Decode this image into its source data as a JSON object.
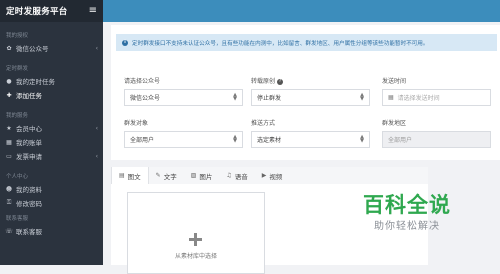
{
  "app": {
    "title": "定时发服务平台"
  },
  "sidebar": {
    "groups": [
      {
        "label": "我的授权",
        "items": [
          {
            "label": "微信公众号",
            "icon": "wechat-icon",
            "chevron": "‹"
          }
        ]
      },
      {
        "label": "定时群发",
        "items": [
          {
            "label": "我的定时任务",
            "icon": "list-icon"
          },
          {
            "label": "添加任务",
            "icon": "plus-icon"
          }
        ]
      },
      {
        "label": "我的服务",
        "items": [
          {
            "label": "会员中心",
            "icon": "star-icon",
            "chevron": "‹"
          },
          {
            "label": "我的账单",
            "icon": "bill-icon"
          },
          {
            "label": "发票申请",
            "icon": "invoice-icon",
            "chevron": "‹"
          }
        ]
      },
      {
        "label": "个人中心",
        "items": [
          {
            "label": "我的资料",
            "icon": "user-icon"
          },
          {
            "label": "修改密码",
            "icon": "key-icon"
          }
        ]
      },
      {
        "label": "联系客服",
        "items": [
          {
            "label": "联系客服",
            "icon": "support-icon"
          }
        ]
      }
    ]
  },
  "alert": {
    "text": "定时群发接口不支持未认证公众号，且有些功能在内测中，比如留言、群发地区、用户属性分组等该些功能暂时不可用。"
  },
  "form": {
    "account": {
      "label": "请选择公众号",
      "value": "微信公众号"
    },
    "reprint": {
      "label": "转载原创",
      "value": "停止群发"
    },
    "send_time": {
      "label": "发送时间",
      "placeholder": "请选择发送时间"
    },
    "target": {
      "label": "群发对象",
      "value": "全部用户"
    },
    "method": {
      "label": "推送方式",
      "value": "选定素材"
    },
    "region": {
      "label": "群发地区",
      "value": "全部用户"
    }
  },
  "tabs": [
    {
      "label": "图文",
      "icon": "▤"
    },
    {
      "label": "文字",
      "icon": "✎"
    },
    {
      "label": "图片",
      "icon": "▨"
    },
    {
      "label": "语音",
      "icon": "♫"
    },
    {
      "label": "视频",
      "icon": "▶"
    }
  ],
  "upload": {
    "text": "从素材库中选择"
  },
  "watermark": {
    "title": "百科全说",
    "subtitle": "助你轻松解决"
  },
  "colors": {
    "sidebar": "#2b333e",
    "topbar": "#3c8dbc",
    "alert_bg": "#d7e8f5",
    "watermark": "#2fa84f"
  }
}
